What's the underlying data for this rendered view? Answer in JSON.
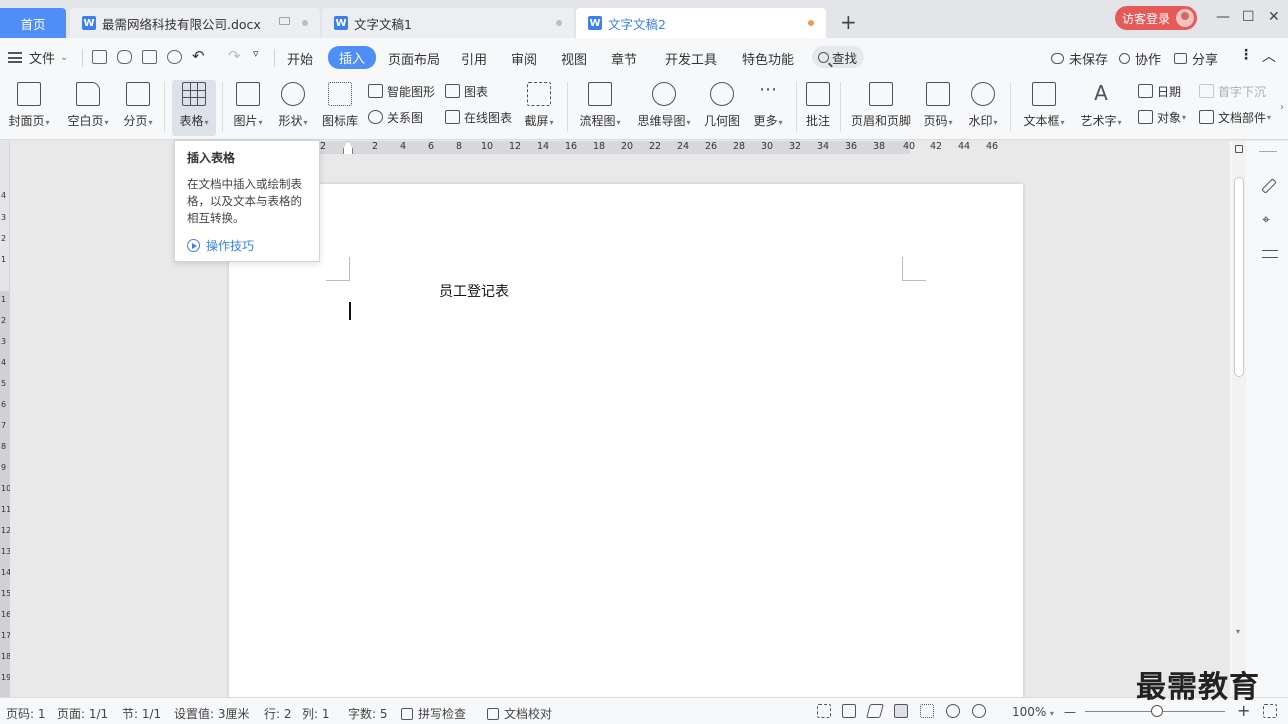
{
  "tabs": {
    "home": "首页",
    "doc1": "最需网络科技有限公司.docx",
    "doc2": "文字文稿1",
    "doc3": "文字文稿2"
  },
  "titlebar": {
    "new_tab": "+",
    "login": "访客登录",
    "minimize": "—",
    "maximize": "☐",
    "close": "✕"
  },
  "menu": {
    "file": "文件",
    "tabs": [
      "开始",
      "插入",
      "页面布局",
      "引用",
      "审阅",
      "视图",
      "章节",
      "开发工具",
      "特色功能"
    ],
    "active_tab": "插入",
    "search": "查找",
    "unsaved": "未保存",
    "collaborate": "协作",
    "share": "分享"
  },
  "ribbon": {
    "cover_page": "封面页",
    "blank_page": "空白页",
    "page_break": "分页",
    "table": "表格",
    "picture": "图片",
    "shape": "形状",
    "icon_lib": "图标库",
    "smart_art": "智能图形",
    "chart": "图表",
    "relation": "关系图",
    "online_chart": "在线图表",
    "screenshot": "截屏",
    "flowchart": "流程图",
    "mindmap": "思维导图",
    "geometry": "几何图",
    "more": "更多",
    "comment": "批注",
    "header_footer": "页眉和页脚",
    "page_number": "页码",
    "watermark": "水印",
    "text_box": "文本框",
    "word_art": "艺术字",
    "date": "日期",
    "object": "对象",
    "drop_cap": "首字下沉",
    "doc_parts": "文档部件"
  },
  "tooltip": {
    "title": "插入表格",
    "desc": "在文档中插入或绘制表格，以及文本与表格的相互转换。",
    "link": "操作技巧"
  },
  "ruler": {
    "ticks": [
      "2",
      "2",
      "4",
      "6",
      "8",
      "10",
      "12",
      "14",
      "16",
      "18",
      "20",
      "22",
      "24",
      "26",
      "28",
      "30",
      "32",
      "34",
      "36",
      "38",
      "40",
      "42",
      "44",
      "46"
    ],
    "vticks": [
      "4",
      "3",
      "2",
      "1",
      "1",
      "2",
      "3",
      "4",
      "5",
      "6",
      "7",
      "8",
      "9",
      "10",
      "11",
      "12",
      "13",
      "14",
      "15",
      "16",
      "17",
      "18",
      "19"
    ]
  },
  "document": {
    "title": "员工登记表"
  },
  "status": {
    "page_no": "页码: 1",
    "pages": "页面: 1/1",
    "section": "节: 1/1",
    "setting": "设置值: 3厘米",
    "row": "行: 2",
    "col": "列: 1",
    "word_count": "字数: 5",
    "spell_check": "拼写检查",
    "doc_check": "文档校对",
    "zoom": "100%",
    "zoom_minus": "—",
    "zoom_plus": "+"
  },
  "brand_watermark": "最需教育"
}
